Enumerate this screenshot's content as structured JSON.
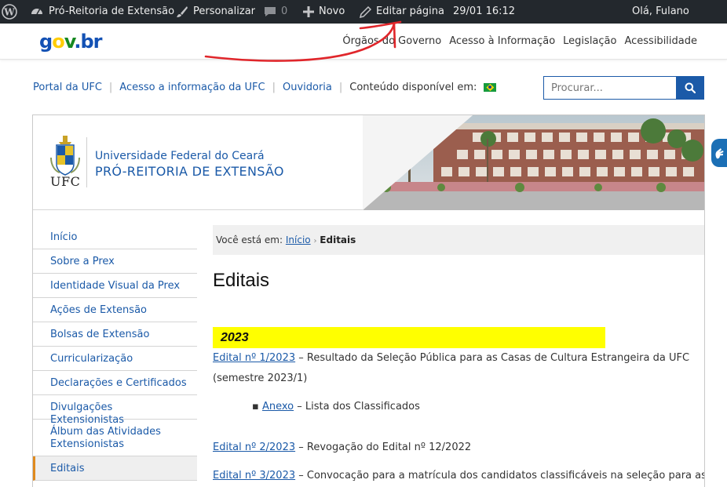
{
  "admin_bar": {
    "site_name": "Pró-Reitoria de Extensão",
    "customize": "Personalizar",
    "comments_count": "0",
    "new": "Novo",
    "edit_page": "Editar página",
    "datetime": "29/01 16:12",
    "greeting": "Olá, Fulano"
  },
  "gov_bar": {
    "logo": {
      "g": "g",
      "o": "o",
      "v": "v",
      "dot": ".",
      "br": "br"
    },
    "links": [
      "Órgãos do Governo",
      "Acesso à Informação",
      "Legislação",
      "Acessibilidade"
    ]
  },
  "top_links": {
    "portal": "Portal da UFC",
    "access": "Acesso a informação da UFC",
    "ombudsman": "Ouvidoria",
    "content_available": "Conteúdo disponível em:"
  },
  "search": {
    "placeholder": "Procurar..."
  },
  "header": {
    "ufc_label": "UFC",
    "university": "Universidade Federal do Ceará",
    "department": "PRÓ-REITORIA DE EXTENSÃO"
  },
  "sidebar": {
    "items": [
      {
        "label": "Início",
        "active": false
      },
      {
        "label": "Sobre a Prex",
        "active": false
      },
      {
        "label": "Identidade Visual da Prex",
        "active": false
      },
      {
        "label": "Ações de Extensão",
        "active": false
      },
      {
        "label": "Bolsas de Extensão",
        "active": false
      },
      {
        "label": "Curricularização",
        "active": false
      },
      {
        "label": "Declarações e Certificados",
        "active": false
      },
      {
        "label": "Divulgações Extensionistas",
        "active": false
      },
      {
        "label": "Álbum das Atividades Extensionistas",
        "active": false
      },
      {
        "label": "Editais",
        "active": true
      }
    ]
  },
  "breadcrumb": {
    "prefix": "Você está em:",
    "home": "Início",
    "current": "Editais"
  },
  "main": {
    "title": "Editais",
    "year": "2023",
    "entries": [
      {
        "link": "Edital nº 1/2023",
        "text": " – Resultado da Seleção Pública para as Casas de Cultura Estrangeira da UFC",
        "text2": "(semestre 2023/1)"
      },
      {
        "bullet_marker": "▪",
        "bullet_link": "Anexo",
        "bullet_text": " – Lista dos Classificados"
      },
      {
        "link": "Edital nº 2/2023",
        "text": " – Revogação do Edital nº 12/2022"
      },
      {
        "link": "Edital nº 3/2023",
        "text": " – Convocação para a matrícula dos candidatos classificáveis na seleção para as Casas"
      }
    ]
  },
  "colors": {
    "admin_bar_bg": "#23282d",
    "link_blue": "#1b5aa8",
    "year_highlight": "#ffff00",
    "active_accent": "#e08a1e",
    "annotation_red": "#e0262b"
  }
}
